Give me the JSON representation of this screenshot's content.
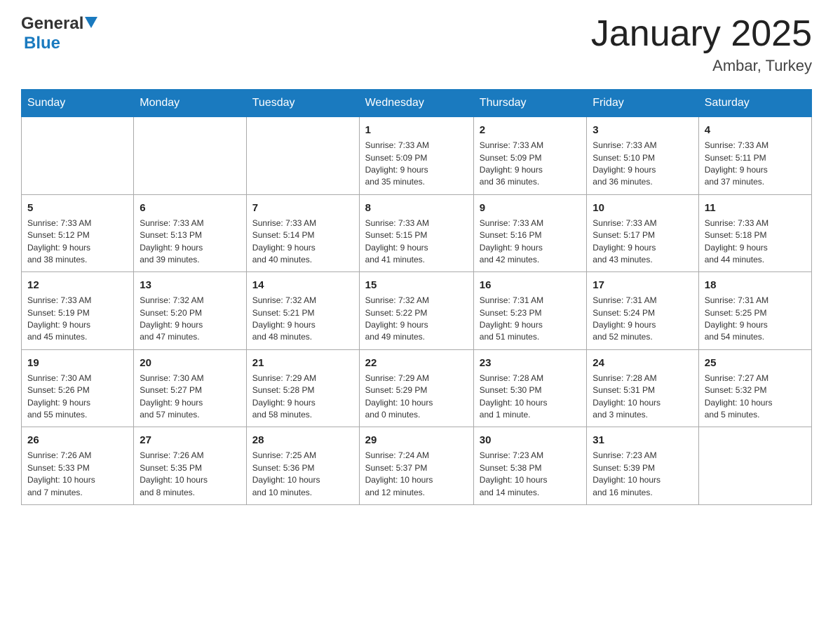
{
  "header": {
    "logo_text_black": "General",
    "logo_text_blue": "Blue",
    "title": "January 2025",
    "subtitle": "Ambar, Turkey"
  },
  "weekdays": [
    "Sunday",
    "Monday",
    "Tuesday",
    "Wednesday",
    "Thursday",
    "Friday",
    "Saturday"
  ],
  "weeks": [
    [
      {
        "day": "",
        "info": ""
      },
      {
        "day": "",
        "info": ""
      },
      {
        "day": "",
        "info": ""
      },
      {
        "day": "1",
        "info": "Sunrise: 7:33 AM\nSunset: 5:09 PM\nDaylight: 9 hours\nand 35 minutes."
      },
      {
        "day": "2",
        "info": "Sunrise: 7:33 AM\nSunset: 5:09 PM\nDaylight: 9 hours\nand 36 minutes."
      },
      {
        "day": "3",
        "info": "Sunrise: 7:33 AM\nSunset: 5:10 PM\nDaylight: 9 hours\nand 36 minutes."
      },
      {
        "day": "4",
        "info": "Sunrise: 7:33 AM\nSunset: 5:11 PM\nDaylight: 9 hours\nand 37 minutes."
      }
    ],
    [
      {
        "day": "5",
        "info": "Sunrise: 7:33 AM\nSunset: 5:12 PM\nDaylight: 9 hours\nand 38 minutes."
      },
      {
        "day": "6",
        "info": "Sunrise: 7:33 AM\nSunset: 5:13 PM\nDaylight: 9 hours\nand 39 minutes."
      },
      {
        "day": "7",
        "info": "Sunrise: 7:33 AM\nSunset: 5:14 PM\nDaylight: 9 hours\nand 40 minutes."
      },
      {
        "day": "8",
        "info": "Sunrise: 7:33 AM\nSunset: 5:15 PM\nDaylight: 9 hours\nand 41 minutes."
      },
      {
        "day": "9",
        "info": "Sunrise: 7:33 AM\nSunset: 5:16 PM\nDaylight: 9 hours\nand 42 minutes."
      },
      {
        "day": "10",
        "info": "Sunrise: 7:33 AM\nSunset: 5:17 PM\nDaylight: 9 hours\nand 43 minutes."
      },
      {
        "day": "11",
        "info": "Sunrise: 7:33 AM\nSunset: 5:18 PM\nDaylight: 9 hours\nand 44 minutes."
      }
    ],
    [
      {
        "day": "12",
        "info": "Sunrise: 7:33 AM\nSunset: 5:19 PM\nDaylight: 9 hours\nand 45 minutes."
      },
      {
        "day": "13",
        "info": "Sunrise: 7:32 AM\nSunset: 5:20 PM\nDaylight: 9 hours\nand 47 minutes."
      },
      {
        "day": "14",
        "info": "Sunrise: 7:32 AM\nSunset: 5:21 PM\nDaylight: 9 hours\nand 48 minutes."
      },
      {
        "day": "15",
        "info": "Sunrise: 7:32 AM\nSunset: 5:22 PM\nDaylight: 9 hours\nand 49 minutes."
      },
      {
        "day": "16",
        "info": "Sunrise: 7:31 AM\nSunset: 5:23 PM\nDaylight: 9 hours\nand 51 minutes."
      },
      {
        "day": "17",
        "info": "Sunrise: 7:31 AM\nSunset: 5:24 PM\nDaylight: 9 hours\nand 52 minutes."
      },
      {
        "day": "18",
        "info": "Sunrise: 7:31 AM\nSunset: 5:25 PM\nDaylight: 9 hours\nand 54 minutes."
      }
    ],
    [
      {
        "day": "19",
        "info": "Sunrise: 7:30 AM\nSunset: 5:26 PM\nDaylight: 9 hours\nand 55 minutes."
      },
      {
        "day": "20",
        "info": "Sunrise: 7:30 AM\nSunset: 5:27 PM\nDaylight: 9 hours\nand 57 minutes."
      },
      {
        "day": "21",
        "info": "Sunrise: 7:29 AM\nSunset: 5:28 PM\nDaylight: 9 hours\nand 58 minutes."
      },
      {
        "day": "22",
        "info": "Sunrise: 7:29 AM\nSunset: 5:29 PM\nDaylight: 10 hours\nand 0 minutes."
      },
      {
        "day": "23",
        "info": "Sunrise: 7:28 AM\nSunset: 5:30 PM\nDaylight: 10 hours\nand 1 minute."
      },
      {
        "day": "24",
        "info": "Sunrise: 7:28 AM\nSunset: 5:31 PM\nDaylight: 10 hours\nand 3 minutes."
      },
      {
        "day": "25",
        "info": "Sunrise: 7:27 AM\nSunset: 5:32 PM\nDaylight: 10 hours\nand 5 minutes."
      }
    ],
    [
      {
        "day": "26",
        "info": "Sunrise: 7:26 AM\nSunset: 5:33 PM\nDaylight: 10 hours\nand 7 minutes."
      },
      {
        "day": "27",
        "info": "Sunrise: 7:26 AM\nSunset: 5:35 PM\nDaylight: 10 hours\nand 8 minutes."
      },
      {
        "day": "28",
        "info": "Sunrise: 7:25 AM\nSunset: 5:36 PM\nDaylight: 10 hours\nand 10 minutes."
      },
      {
        "day": "29",
        "info": "Sunrise: 7:24 AM\nSunset: 5:37 PM\nDaylight: 10 hours\nand 12 minutes."
      },
      {
        "day": "30",
        "info": "Sunrise: 7:23 AM\nSunset: 5:38 PM\nDaylight: 10 hours\nand 14 minutes."
      },
      {
        "day": "31",
        "info": "Sunrise: 7:23 AM\nSunset: 5:39 PM\nDaylight: 10 hours\nand 16 minutes."
      },
      {
        "day": "",
        "info": ""
      }
    ]
  ]
}
